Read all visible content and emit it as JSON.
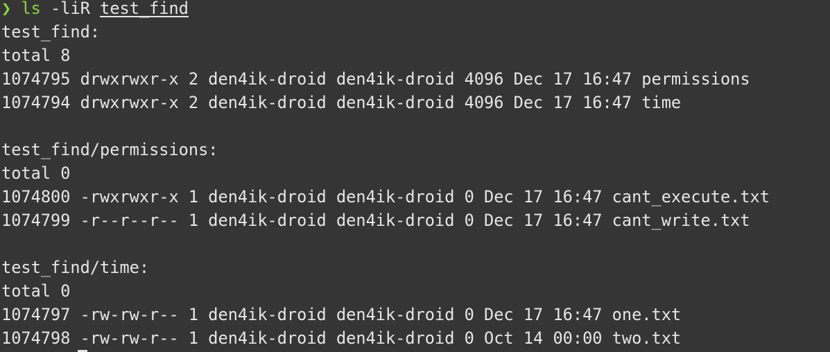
{
  "terminal": {
    "prompt": {
      "symbol": "❯",
      "command": "ls",
      "flags": "-liR",
      "path": "test_find"
    },
    "output": [
      "test_find:",
      "total 8",
      "1074795 drwxrwxr-x 2 den4ik-droid den4ik-droid 4096 Dec 17 16:47 permissions",
      "1074794 drwxrwxr-x 2 den4ik-droid den4ik-droid 4096 Dec 17 16:47 time",
      "",
      "test_find/permissions:",
      "total 0",
      "1074800 -rwxrwxr-x 1 den4ik-droid den4ik-droid 0 Dec 17 16:47 cant_execute.txt",
      "1074799 -r--r--r-- 1 den4ik-droid den4ik-droid 0 Dec 17 16:47 cant_write.txt",
      "",
      "test_find/time:",
      "total 0",
      "1074797 -rw-rw-r-- 1 den4ik-droid den4ik-droid 0 Dec 17 16:47 one.txt",
      "1074798 -rw-rw-r-- 1 den4ik-droid den4ik-droid 0 Oct 14 00:00 two.txt"
    ],
    "colors": {
      "background": "#353535",
      "foreground": "#e6e6e6",
      "prompt_accent": "#8bd63f"
    }
  }
}
